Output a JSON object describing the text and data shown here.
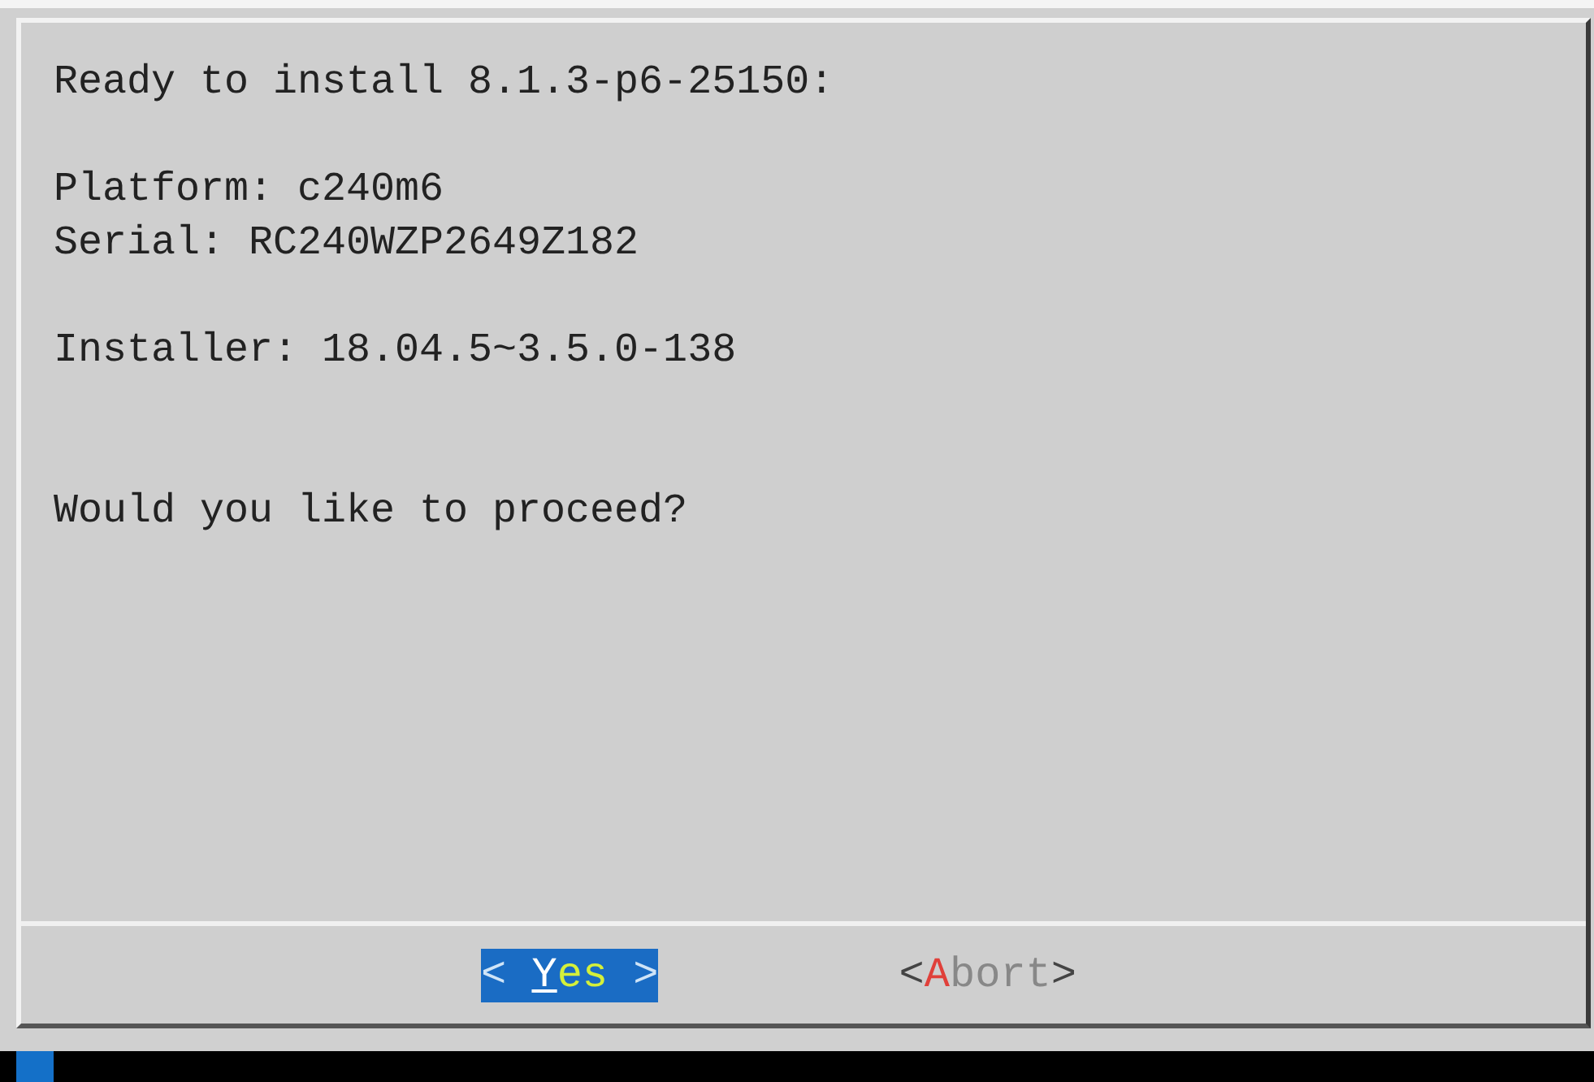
{
  "dialog": {
    "paragraphs": [
      {
        "kind": "info",
        "lines": [
          "Ready to install 8.1.3-p6-25150:"
        ]
      },
      {
        "kind": "info",
        "lines": [
          "Platform: c240m6",
          "Serial: RC240WZP2649Z182"
        ]
      },
      {
        "kind": "info",
        "lines": [
          "Installer: 18.04.5~3.5.0-138"
        ]
      },
      {
        "kind": "question",
        "lines": [
          "Would you like to proceed?"
        ]
      }
    ]
  },
  "buttons": [
    {
      "open": "< ",
      "hotkey": "Y",
      "rest": "es",
      "close": " >",
      "selected": true
    },
    {
      "open": "<",
      "hotkey": "A",
      "rest": "bort",
      "close": ">",
      "selected": false
    }
  ]
}
